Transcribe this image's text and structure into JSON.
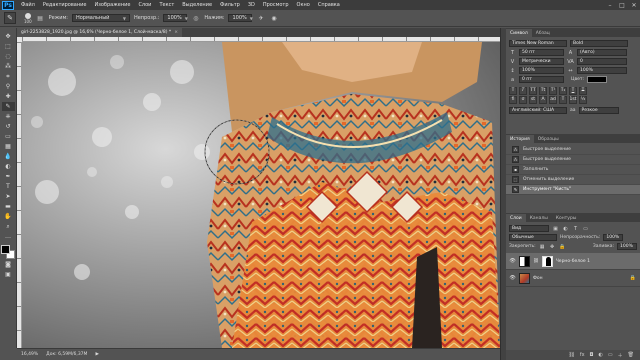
{
  "app": {
    "logo": "Ps"
  },
  "menu": [
    "Файл",
    "Редактирование",
    "Изображение",
    "Слои",
    "Текст",
    "Выделение",
    "Фильтр",
    "3D",
    "Просмотр",
    "Окно",
    "Справка"
  ],
  "window_controls": {
    "minimize": "–",
    "maximize": "□",
    "close": "✕"
  },
  "options": {
    "brush_size": "100",
    "mode_label": "Режим:",
    "mode_value": "Нормальный",
    "opacity_label": "Непрозр.:",
    "opacity_value": "100%",
    "flow_label": "Нажим:",
    "flow_value": "100%"
  },
  "document_tab": {
    "title": "girl-2253828_1920.jpg @ 16,6% (Черно-белое 1, Слой-маска/8) *",
    "close": "×"
  },
  "status": {
    "zoom": "16,49%",
    "doc_size": "Док: 6,59M/6,37M"
  },
  "character_panel": {
    "tabs": [
      "Символ",
      "Абзац"
    ],
    "font_family": "Times New Roman",
    "font_style": "Bold",
    "font_size": "50 пт",
    "leading": "(Авто)",
    "kerning": "Метрически",
    "tracking": "0",
    "vertical_scale": "100%",
    "horizontal_scale": "100%",
    "baseline": "0 пт",
    "color_label": "Цвет:",
    "text_buttons": [
      "T",
      "T",
      "TT",
      "Tt",
      "T¹",
      "T₁",
      "T",
      "T"
    ],
    "language": "Английский: США",
    "antialias": "Резкое",
    "antialias_prefix": "aa"
  },
  "history_panel": {
    "tabs": [
      "История",
      "Образцы"
    ],
    "items": [
      "Быстрое выделение",
      "Быстрое выделение",
      "Заполнить",
      "Отменить выделение",
      "Инструмент \"Кисть\""
    ]
  },
  "layers_panel": {
    "tabs": [
      "Слои",
      "Каналы",
      "Контуры"
    ],
    "filter_value": "Вид",
    "blend_mode": "Обычные",
    "opacity_label": "Непрозрачность:",
    "opacity_value": "100%",
    "lock_label": "Закрепить:",
    "fill_label": "Заливка:",
    "fill_value": "100%",
    "layers": [
      {
        "name": "Черно-белое 1",
        "active": true
      },
      {
        "name": "Фон",
        "active": false
      }
    ]
  },
  "colors": {
    "menubar": "#3c3c3c",
    "panel": "#535353",
    "selection": "#6b6b6b",
    "ps_blue": "#31a8ff"
  }
}
